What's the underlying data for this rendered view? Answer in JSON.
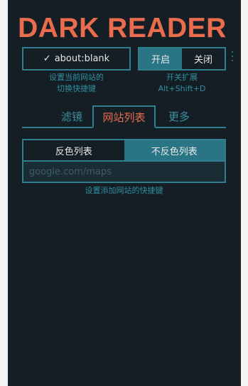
{
  "app": {
    "title": "DARK READER"
  },
  "site_toggle": {
    "check_icon": "✓",
    "label": "about:blank",
    "hint_line1": "设置当前网站的",
    "hint_line2": "切换快捷键"
  },
  "extension_toggle": {
    "on_label": "开启",
    "off_label": "关闭",
    "active": "on",
    "hint_line1": "开关扩展",
    "hint_line2": "Alt+Shift+D"
  },
  "tabs": {
    "filter": "滤镜",
    "site_list": "网站列表",
    "more": "更多",
    "active": "site_list"
  },
  "site_list": {
    "invert_label": "反色列表",
    "not_invert_label": "不反色列表",
    "active": "not_invert",
    "input_placeholder": "google.com/maps",
    "input_value": "",
    "hint": "设置添加网站的快捷键"
  },
  "colors": {
    "accent": "#e96c4c",
    "border": "#2f7f8e",
    "active_bg": "#2a7585",
    "background": "#141e24",
    "hint_text": "#2f8fa0"
  }
}
